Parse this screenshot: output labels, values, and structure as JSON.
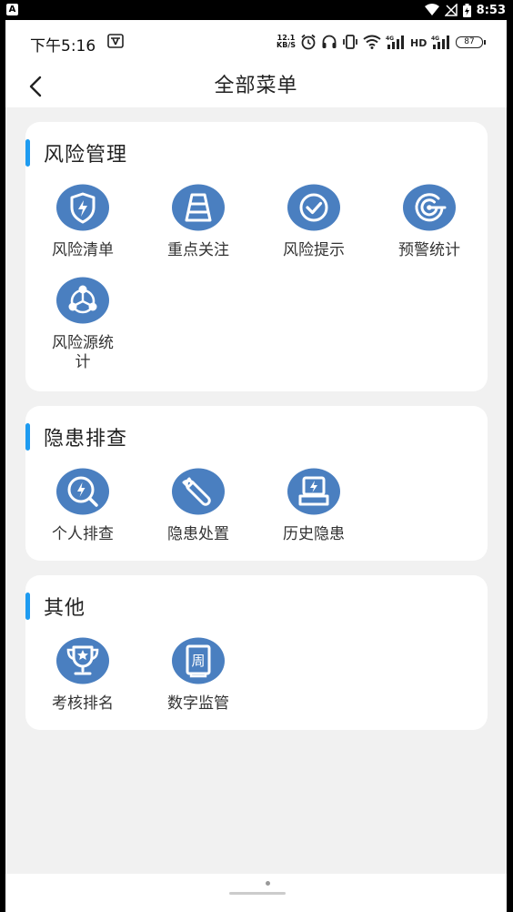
{
  "emulator": {
    "badge": "A",
    "time": "8:53"
  },
  "status": {
    "time": "下午5:16",
    "speed_top": "12.1",
    "speed_bottom": "KB/S",
    "net1": "4G",
    "net2": "4G",
    "battery": "87"
  },
  "header": {
    "title": "全部菜单"
  },
  "sections": [
    {
      "title": "风险管理",
      "items": [
        {
          "label": "风险清单",
          "icon": "shield-bolt-icon"
        },
        {
          "label": "重点关注",
          "icon": "road-icon"
        },
        {
          "label": "风险提示",
          "icon": "check-circle-icon"
        },
        {
          "label": "预警统计",
          "icon": "radar-icon"
        },
        {
          "label": "风险源统\n计",
          "icon": "network-icon"
        }
      ]
    },
    {
      "title": "隐患排查",
      "items": [
        {
          "label": "个人排查",
          "icon": "search-bolt-icon"
        },
        {
          "label": "隐患处置",
          "icon": "wrench-icon"
        },
        {
          "label": "历史隐患",
          "icon": "inbox-bolt-icon"
        }
      ]
    },
    {
      "title": "其他",
      "items": [
        {
          "label": "考核排名",
          "icon": "trophy-icon"
        },
        {
          "label": "数字监管",
          "icon": "calendar-week-icon",
          "glyph": "周"
        }
      ]
    }
  ],
  "colors": {
    "accent": "#1e9bf0",
    "icon_fill": "#4a7fc0"
  }
}
